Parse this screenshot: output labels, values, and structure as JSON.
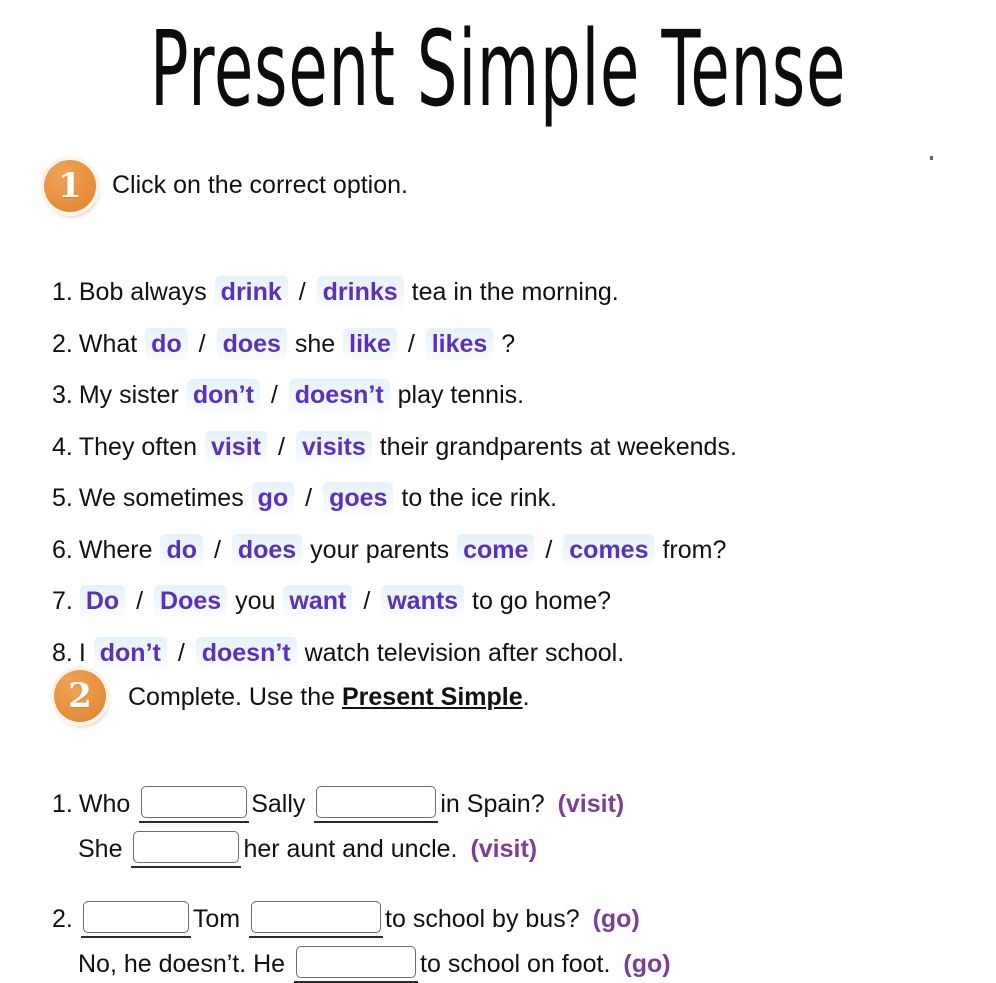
{
  "page": {
    "title": "Present Simple Tense",
    "accent_orange": "#e8913d",
    "choice_text_color": "#5b2fc4",
    "choice_bg_color": "#eef7fb",
    "hint_color": "#7b3f98"
  },
  "exercise_1": {
    "number": "1",
    "instruction": "Click on the correct option.",
    "questions": [
      {
        "num": "1.",
        "parts": [
          {
            "type": "text",
            "text": "Bob always"
          },
          {
            "type": "choice",
            "text": "drink"
          },
          {
            "type": "sep",
            "text": "/"
          },
          {
            "type": "choice",
            "text": "drinks"
          },
          {
            "type": "text",
            "text": "tea in the morning."
          }
        ]
      },
      {
        "num": "2.",
        "parts": [
          {
            "type": "text",
            "text": "What"
          },
          {
            "type": "choice",
            "text": "do"
          },
          {
            "type": "sep",
            "text": "/"
          },
          {
            "type": "choice",
            "text": "does"
          },
          {
            "type": "text",
            "text": "she"
          },
          {
            "type": "choice",
            "text": "like"
          },
          {
            "type": "sep",
            "text": "/"
          },
          {
            "type": "choice",
            "text": "likes"
          },
          {
            "type": "tight",
            "text": "?"
          }
        ]
      },
      {
        "num": "3.",
        "parts": [
          {
            "type": "text",
            "text": "My sister"
          },
          {
            "type": "choice",
            "text": "don’t"
          },
          {
            "type": "sep",
            "text": "/"
          },
          {
            "type": "choice",
            "text": "doesn’t"
          },
          {
            "type": "text",
            "text": "play tennis."
          }
        ]
      },
      {
        "num": "4.",
        "parts": [
          {
            "type": "text",
            "text": "They often"
          },
          {
            "type": "choice",
            "text": "visit"
          },
          {
            "type": "sep",
            "text": "/"
          },
          {
            "type": "choice",
            "text": "visits"
          },
          {
            "type": "text",
            "text": "their grandparents at weekends."
          }
        ]
      },
      {
        "num": "5.",
        "parts": [
          {
            "type": "text",
            "text": "We sometimes"
          },
          {
            "type": "choice",
            "text": "go"
          },
          {
            "type": "sep",
            "text": "/"
          },
          {
            "type": "choice",
            "text": "goes"
          },
          {
            "type": "text",
            "text": "to the ice rink."
          }
        ]
      },
      {
        "num": "6.",
        "parts": [
          {
            "type": "text",
            "text": "Where"
          },
          {
            "type": "choice",
            "text": "do"
          },
          {
            "type": "sep",
            "text": "/"
          },
          {
            "type": "choice",
            "text": "does"
          },
          {
            "type": "text",
            "text": "your parents"
          },
          {
            "type": "choice",
            "text": "come"
          },
          {
            "type": "sep",
            "text": "/"
          },
          {
            "type": "choice",
            "text": "comes"
          },
          {
            "type": "text",
            "text": "from?"
          }
        ]
      },
      {
        "num": "7.",
        "parts": [
          {
            "type": "choice",
            "text": "Do"
          },
          {
            "type": "sep",
            "text": "/"
          },
          {
            "type": "choice",
            "text": "Does"
          },
          {
            "type": "text",
            "text": "you"
          },
          {
            "type": "choice",
            "text": "want"
          },
          {
            "type": "sep",
            "text": "/"
          },
          {
            "type": "choice",
            "text": "wants"
          },
          {
            "type": "text",
            "text": "to go home?"
          }
        ]
      },
      {
        "num": "8.",
        "parts": [
          {
            "type": "text",
            "text": "I"
          },
          {
            "type": "choice",
            "text": "don’t"
          },
          {
            "type": "sep",
            "text": "/"
          },
          {
            "type": "choice",
            "text": "doesn’t"
          },
          {
            "type": "text",
            "text": "watch television after school."
          }
        ]
      }
    ]
  },
  "exercise_2": {
    "number": "2",
    "instruction_prefix": "Complete. Use the ",
    "instruction_emphasis": "Present Simple",
    "instruction_suffix": ".",
    "items": [
      {
        "num": "1.",
        "indent": false,
        "parts": [
          {
            "type": "text",
            "text": "Who"
          },
          {
            "type": "blank",
            "size": "w-s",
            "value": ""
          },
          {
            "type": "text",
            "text": "Sally"
          },
          {
            "type": "blank",
            "size": "w-m",
            "value": ""
          },
          {
            "type": "text",
            "text": "in Spain?"
          },
          {
            "type": "hint",
            "text": "(visit)"
          }
        ]
      },
      {
        "num": "",
        "indent": true,
        "parts": [
          {
            "type": "text",
            "text": "She"
          },
          {
            "type": "blank",
            "size": "w-s",
            "value": ""
          },
          {
            "type": "text",
            "text": "her aunt and uncle."
          },
          {
            "type": "hint",
            "text": "(visit)"
          }
        ]
      },
      {
        "num": "2.",
        "indent": false,
        "parts": [
          {
            "type": "blank",
            "size": "w-s",
            "value": ""
          },
          {
            "type": "text",
            "text": "Tom"
          },
          {
            "type": "blank",
            "size": "w-l",
            "value": ""
          },
          {
            "type": "text",
            "text": "to school by bus?"
          },
          {
            "type": "hint",
            "text": "(go)"
          }
        ]
      },
      {
        "num": "",
        "indent": true,
        "parts": [
          {
            "type": "text",
            "text": "No, he doesn’t. He"
          },
          {
            "type": "blank",
            "size": "w-m",
            "value": ""
          },
          {
            "type": "text",
            "text": "to school on foot."
          },
          {
            "type": "hint",
            "text": "(go)"
          }
        ]
      }
    ]
  }
}
